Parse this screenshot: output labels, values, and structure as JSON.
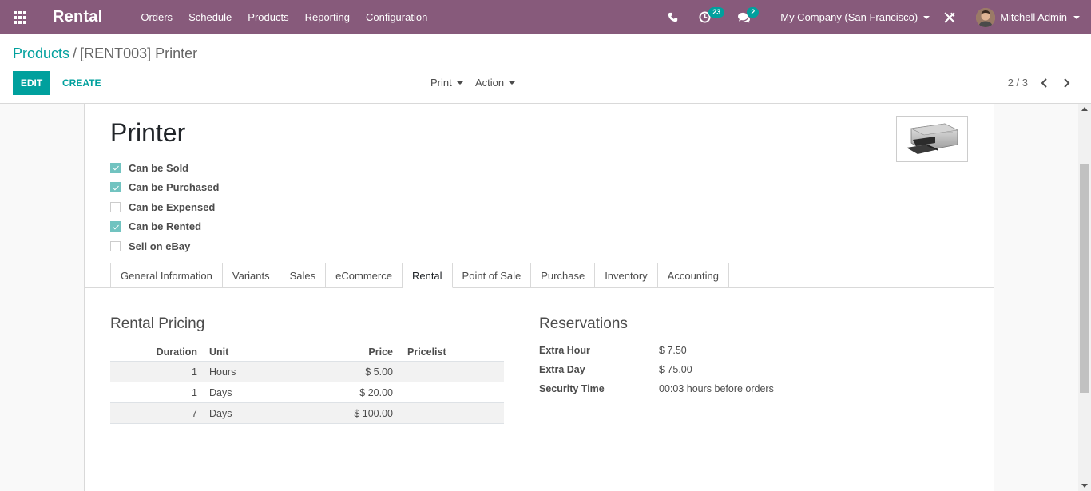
{
  "navbar": {
    "brand": "Rental",
    "menu": [
      "Orders",
      "Schedule",
      "Products",
      "Reporting",
      "Configuration"
    ],
    "activities_count": "23",
    "messages_count": "2",
    "company": "My Company (San Francisco)",
    "user": "Mitchell Admin",
    "color": "#875a7b"
  },
  "control": {
    "breadcrumb_parent": "Products",
    "breadcrumb_separator": "/",
    "breadcrumb_current": "[RENT003] Printer",
    "edit_label": "EDIT",
    "create_label": "CREATE",
    "print_label": "Print",
    "action_label": "Action",
    "pager": "2 / 3",
    "accent": "#00a09d"
  },
  "product": {
    "name": "Printer",
    "checkboxes": [
      {
        "label": "Can be Sold",
        "checked": true
      },
      {
        "label": "Can be Purchased",
        "checked": true
      },
      {
        "label": "Can be Expensed",
        "checked": false
      },
      {
        "label": "Can be Rented",
        "checked": true
      },
      {
        "label": "Sell on eBay",
        "checked": false
      }
    ]
  },
  "tabs": [
    "General Information",
    "Variants",
    "Sales",
    "eCommerce",
    "Rental",
    "Point of Sale",
    "Purchase",
    "Inventory",
    "Accounting"
  ],
  "active_tab": "Rental",
  "rental_pricing": {
    "title": "Rental Pricing",
    "columns": [
      "Duration",
      "Unit",
      "Price",
      "Pricelist"
    ],
    "rows": [
      {
        "duration": "1",
        "unit": "Hours",
        "price": "$ 5.00",
        "pricelist": ""
      },
      {
        "duration": "1",
        "unit": "Days",
        "price": "$ 20.00",
        "pricelist": ""
      },
      {
        "duration": "7",
        "unit": "Days",
        "price": "$ 100.00",
        "pricelist": ""
      }
    ]
  },
  "reservations": {
    "title": "Reservations",
    "fields": [
      {
        "label": "Extra Hour",
        "value": "$ 7.50"
      },
      {
        "label": "Extra Day",
        "value": "$ 75.00"
      },
      {
        "label": "Security Time",
        "value": "00:03 hours before orders"
      }
    ]
  }
}
